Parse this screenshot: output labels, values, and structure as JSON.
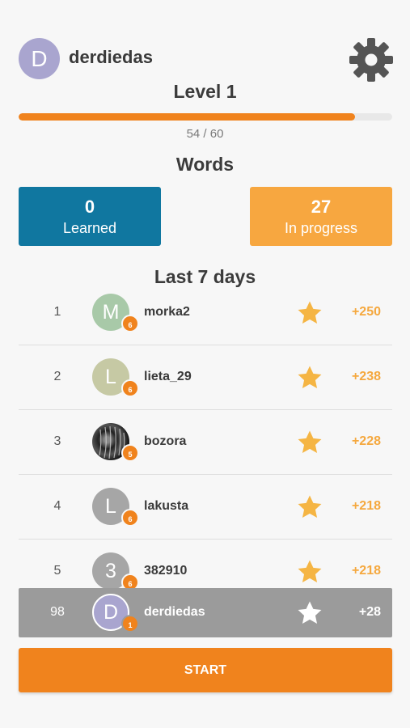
{
  "header": {
    "avatar_letter": "D",
    "username": "derdiedas",
    "settings_icon": "gear-icon"
  },
  "level": {
    "title": "Level 1",
    "progress_text": "54 / 60",
    "progress_fraction": 0.9
  },
  "words": {
    "title": "Words",
    "learned_count": "0",
    "learned_label": "Learned",
    "progress_count": "27",
    "progress_label": "In progress"
  },
  "leaderboard": {
    "title": "Last 7 days",
    "rows": [
      {
        "rank": "1",
        "avatar_letter": "M",
        "avatar_color": "#a8c9a8",
        "badge": "6",
        "name": "morka2",
        "points": "+250"
      },
      {
        "rank": "2",
        "avatar_letter": "L",
        "avatar_color": "#c6c9a4",
        "badge": "6",
        "name": "lieta_29",
        "points": "+238"
      },
      {
        "rank": "3",
        "avatar_letter": "",
        "avatar_color": "#333333",
        "badge": "5",
        "name": "bozora",
        "points": "+228"
      },
      {
        "rank": "4",
        "avatar_letter": "L",
        "avatar_color": "#a6a6a6",
        "badge": "6",
        "name": "lakusta",
        "points": "+218"
      },
      {
        "rank": "5",
        "avatar_letter": "3",
        "avatar_color": "#a6a6a6",
        "badge": "6",
        "name": "382910",
        "points": "+218"
      }
    ],
    "me": {
      "rank": "98",
      "avatar_letter": "D",
      "badge": "1",
      "name": "derdiedas",
      "points": "+28"
    }
  },
  "start_button": {
    "label": "START"
  },
  "colors": {
    "accent": "#f0831d",
    "learned": "#1077a0",
    "in_progress": "#f7a740",
    "star": "#f5b544"
  }
}
